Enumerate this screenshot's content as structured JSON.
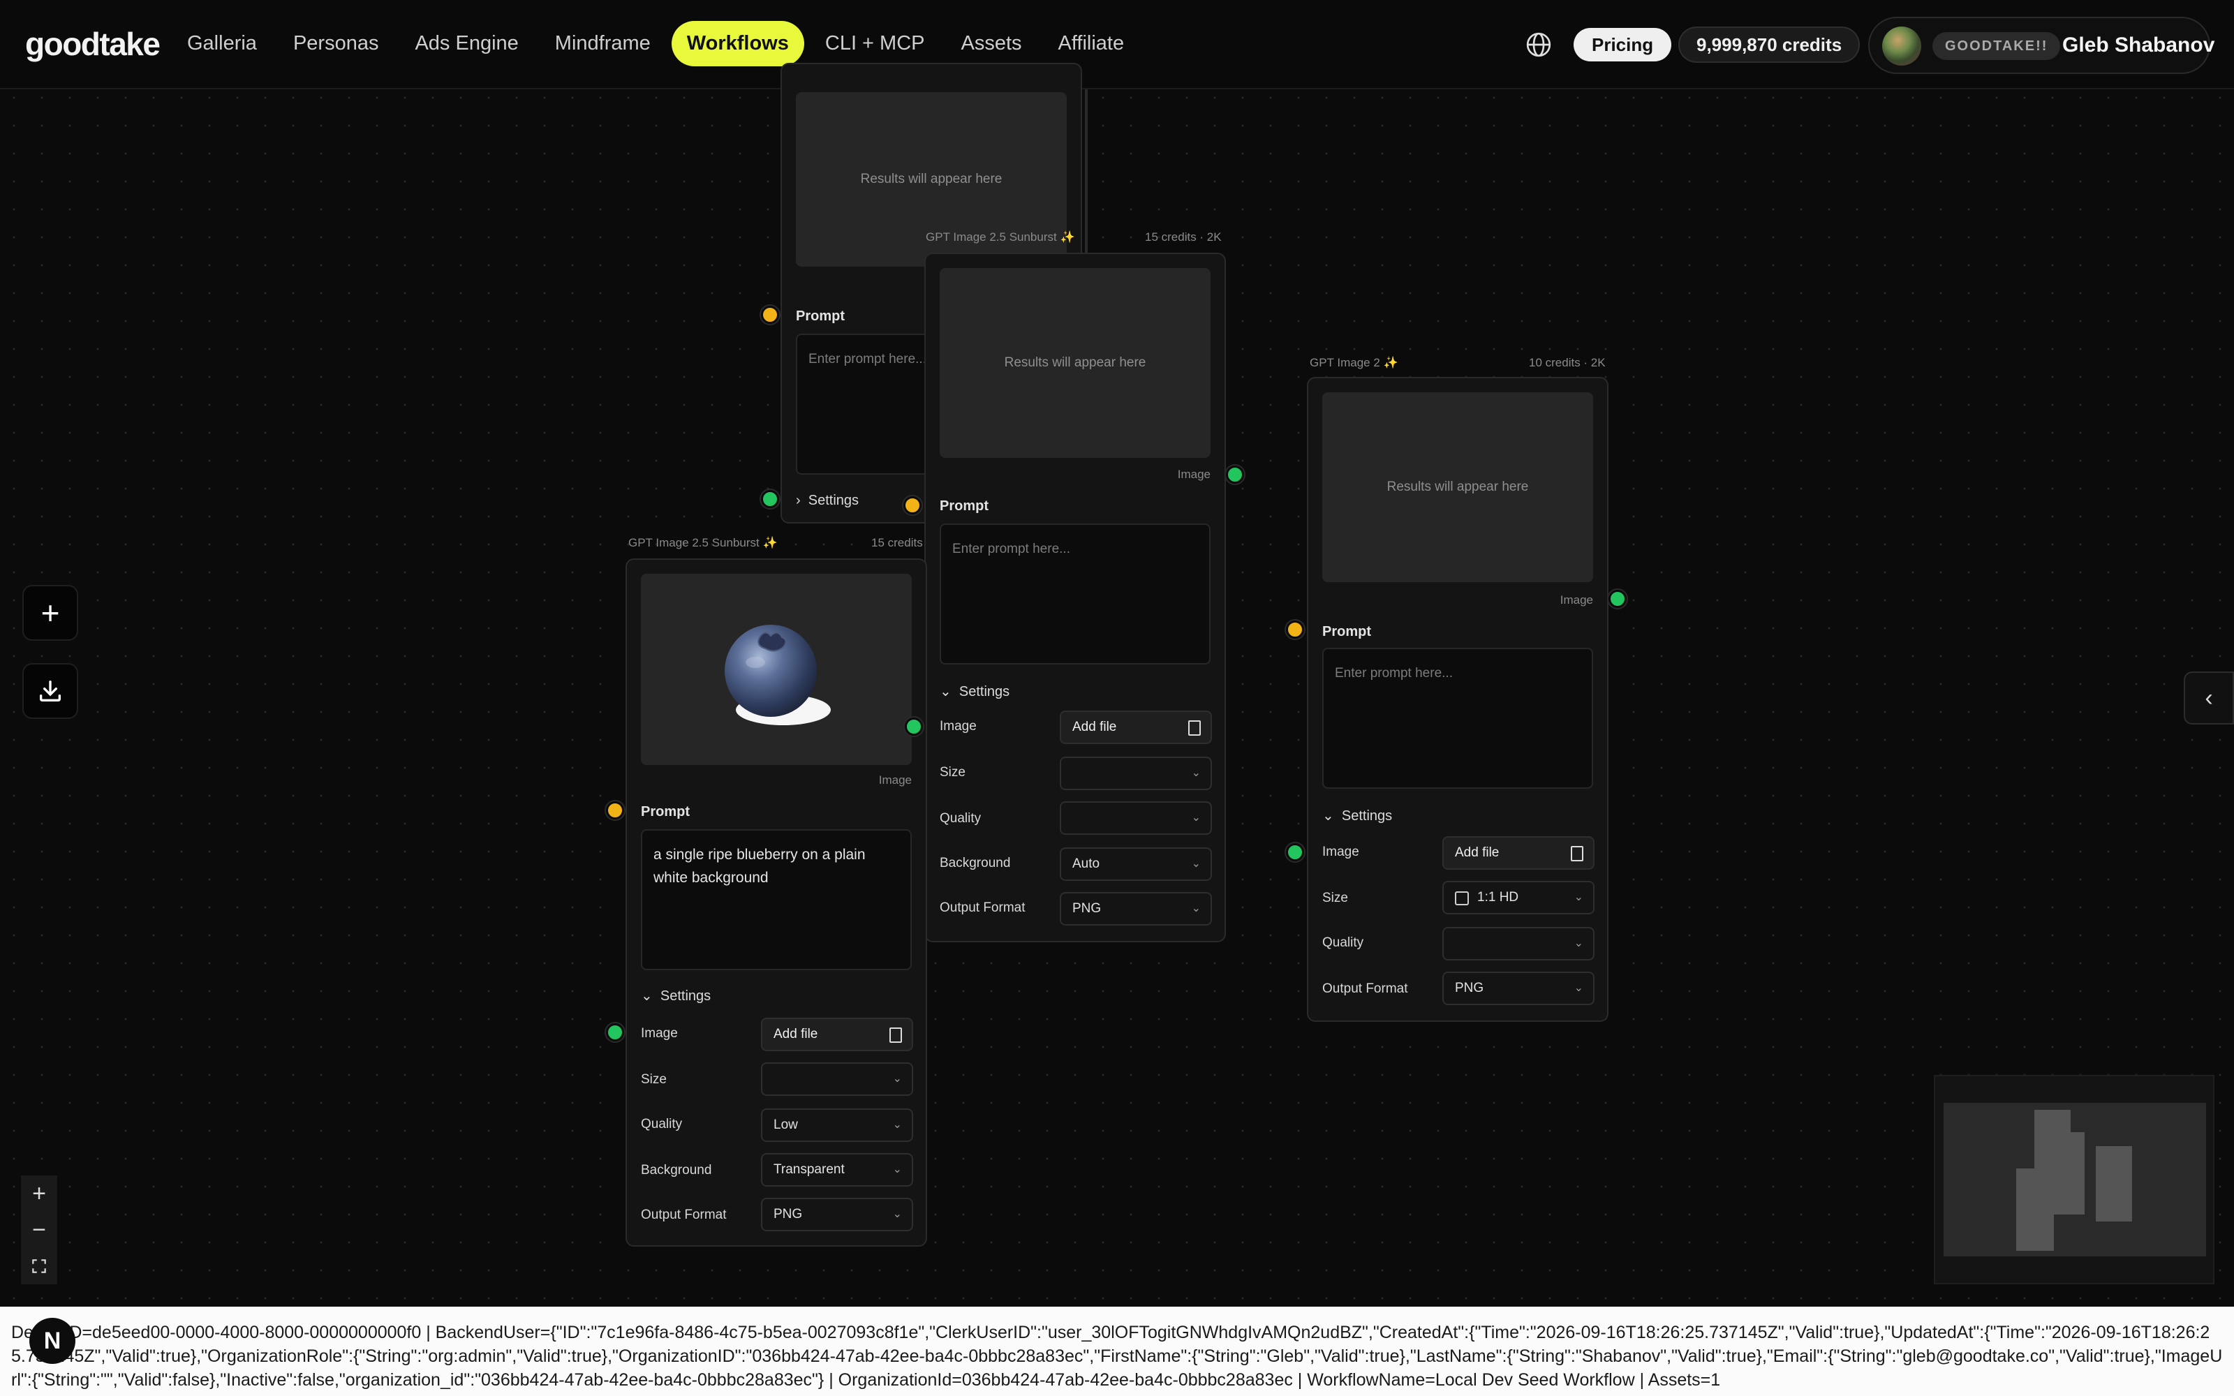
{
  "app": {
    "logo": "goodtake",
    "nav": [
      "Galleria",
      "Personas",
      "Ads Engine",
      "Mindframe",
      "Workflows",
      "CLI + MCP",
      "Assets",
      "Affiliate"
    ],
    "active_nav": "Workflows",
    "pricing_label": "Pricing",
    "credits_label": "9,999,870 credits",
    "org_badge": "GOODTAKE!!",
    "user_name": "Gleb Shabanov",
    "accent_color": "#e8f83a"
  },
  "canvas": {
    "nodes": [
      {
        "id": "node-top",
        "results_placeholder": "Results will appear here",
        "prompt_label": "Prompt",
        "prompt_placeholder": "Enter prompt here...",
        "settings_label": "Settings"
      },
      {
        "id": "node-middle",
        "title": "GPT Image 2.5 Sunburst ✨",
        "meta": "15 credits · 2K",
        "results_placeholder": "Results will appear here",
        "image_label": "Image",
        "prompt_label": "Prompt",
        "prompt_placeholder": "Enter prompt here...",
        "settings_label": "Settings",
        "settings": {
          "image_label": "Image",
          "image_button": "Add file",
          "size_label": "Size",
          "size_value": "",
          "quality_label": "Quality",
          "quality_value": "",
          "background_label": "Background",
          "background_value": "Auto",
          "format_label": "Output Format",
          "format_value": "PNG"
        }
      },
      {
        "id": "node-right",
        "title": "GPT Image 2 ✨",
        "meta": "10 credits · 2K",
        "results_placeholder": "Results will appear here",
        "image_label": "Image",
        "prompt_label": "Prompt",
        "prompt_placeholder": "Enter prompt here...",
        "settings_label": "Settings",
        "settings": {
          "image_label": "Image",
          "image_button": "Add file",
          "size_label": "Size",
          "size_value": "1:1 HD",
          "quality_label": "Quality",
          "quality_value": "",
          "format_label": "Output Format",
          "format_value": "PNG"
        }
      },
      {
        "id": "node-blueberry",
        "title": "GPT Image 2.5 Sunburst ✨",
        "meta": "15 credits",
        "image_label": "Image",
        "prompt_label": "Prompt",
        "prompt_value": "a single ripe blueberry on a plain white background",
        "settings_label": "Settings",
        "settings": {
          "image_label": "Image",
          "image_button": "Add file",
          "size_label": "Size",
          "size_value": "",
          "quality_label": "Quality",
          "quality_value": "Low",
          "background_label": "Background",
          "background_value": "Transparent",
          "format_label": "Output Format",
          "format_value": "PNG"
        }
      }
    ]
  },
  "debug": {
    "badge": "N",
    "text": "DeviceID=de5eed00-0000-4000-8000-0000000000f0 | BackendUser={\"ID\":\"7c1e96fa-8486-4c75-b5ea-0027093c8f1e\",\"ClerkUserID\":\"user_30lOFTogitGNWhdgIvAMQn2udBZ\",\"CreatedAt\":{\"Time\":\"2026-09-16T18:26:25.737145Z\",\"Valid\":true},\"UpdatedAt\":{\"Time\":\"2026-09-16T18:26:25.737145Z\",\"Valid\":true},\"OrganizationRole\":{\"String\":\"org:admin\",\"Valid\":true},\"OrganizationID\":\"036bb424-47ab-42ee-ba4c-0bbbc28a83ec\",\"FirstName\":{\"String\":\"Gleb\",\"Valid\":true},\"LastName\":{\"String\":\"Shabanov\",\"Valid\":true},\"Email\":{\"String\":\"gleb@goodtake.co\",\"Valid\":true},\"ImageUrl\":{\"String\":\"\",\"Valid\":false},\"Inactive\":false,\"organization_id\":\"036bb424-47ab-42ee-ba4c-0bbbc28a83ec\"} | OrganizationId=036bb424-47ab-42ee-ba4c-0bbbc28a83ec | WorkflowName=Local Dev Seed Workflow | Assets=1"
  }
}
